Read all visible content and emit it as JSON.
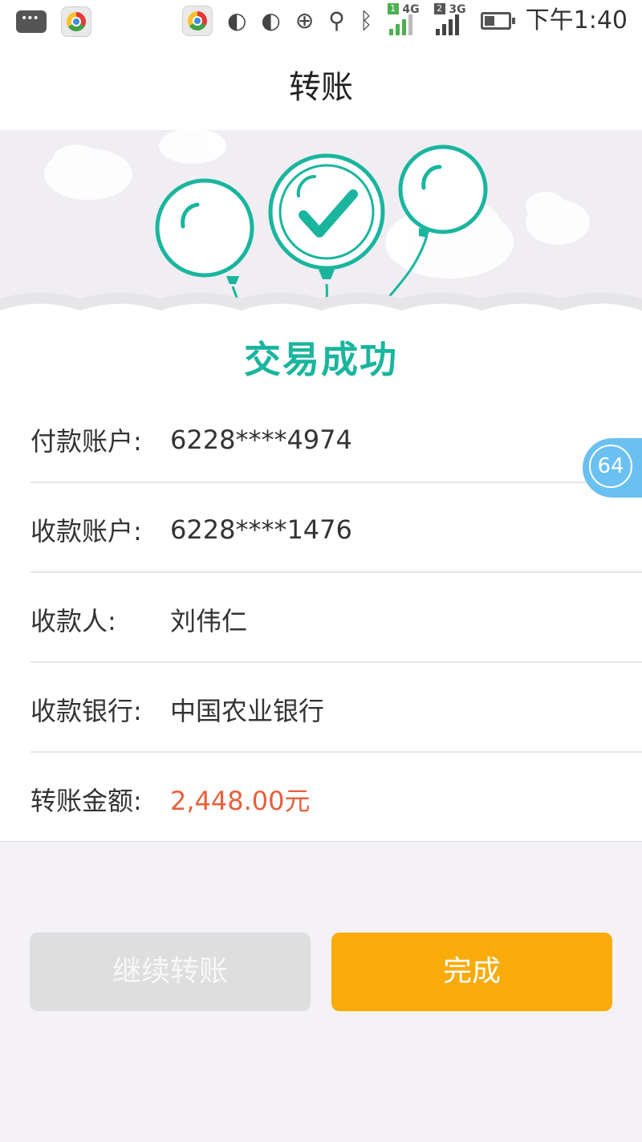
{
  "status_bar": {
    "sim1_label": "4G",
    "sim1_number": "1",
    "sim2_label": "3G",
    "sim2_number": "2",
    "time": "下午1:40"
  },
  "header": {
    "title": "转账"
  },
  "banner": {
    "success_text": "交易成功"
  },
  "details": {
    "payer_account": {
      "label": "付款账户:",
      "value": "6228****4974"
    },
    "payee_account": {
      "label": "收款账户:",
      "value": "6228****1476"
    },
    "payee_name": {
      "label": "收款人:",
      "value": "刘伟仁"
    },
    "payee_bank": {
      "label": "收款银行:",
      "value": "中国农业银行"
    },
    "amount": {
      "label": "转账金额:",
      "value": "2,448.00元"
    }
  },
  "floating_badge": {
    "value": "64"
  },
  "buttons": {
    "continue_label": "继续转账",
    "done_label": "完成"
  },
  "colors": {
    "accent_green": "#1ab59e",
    "amount_red": "#e8603c",
    "done_orange": "#f9ab0c",
    "badge_blue": "#6ac0f0"
  }
}
